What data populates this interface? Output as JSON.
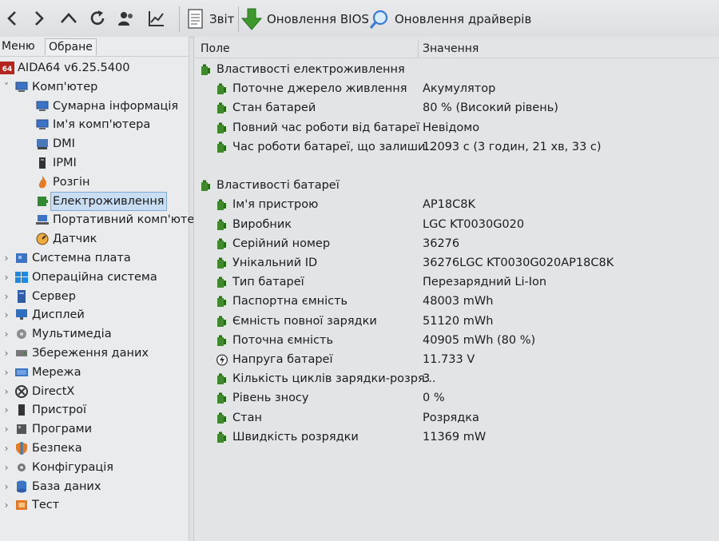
{
  "toolbar": {
    "nav_buttons": [
      "back",
      "forward",
      "up",
      "refresh",
      "users",
      "chart"
    ],
    "report_label": "Звіт",
    "bios_update_label": "Оновлення BIOS",
    "driver_update_label": "Оновлення драйверів"
  },
  "left_panel": {
    "tabs": [
      "Меню",
      "Обране"
    ],
    "tree": [
      {
        "label": "AIDA64 v6.25.5400",
        "icon": "aida64-logo-icon",
        "expander": ""
      },
      {
        "label": "Комп'ютер",
        "icon": "computer-icon",
        "expander": "˅"
      },
      {
        "label": "Сумарна інформація",
        "icon": "summary-icon",
        "expander": ""
      },
      {
        "label": "Ім'я комп'ютера",
        "icon": "computer-name-icon",
        "expander": ""
      },
      {
        "label": "DMI",
        "icon": "dmi-icon",
        "expander": ""
      },
      {
        "label": "IPMI",
        "icon": "ipmi-icon",
        "expander": ""
      },
      {
        "label": "Розгін",
        "icon": "overclock-flame-icon",
        "expander": ""
      },
      {
        "label": "Електроживлення",
        "icon": "power-battery-icon",
        "expander": ""
      },
      {
        "label": "Портативний комп'юте",
        "icon": "laptop-icon",
        "expander": ""
      },
      {
        "label": "Датчик",
        "icon": "sensor-gauge-icon",
        "expander": ""
      },
      {
        "label": "Системна плата",
        "icon": "motherboard-icon",
        "expander": "›"
      },
      {
        "label": "Операційна система",
        "icon": "windows-icon",
        "expander": "›"
      },
      {
        "label": "Сервер",
        "icon": "server-icon",
        "expander": "›"
      },
      {
        "label": "Дисплей",
        "icon": "display-icon",
        "expander": "›"
      },
      {
        "label": "Мультимедіа",
        "icon": "multimedia-icon",
        "expander": "›"
      },
      {
        "label": "Збереження даних",
        "icon": "storage-icon",
        "expander": "›"
      },
      {
        "label": "Мережа",
        "icon": "network-icon",
        "expander": "›"
      },
      {
        "label": "DirectX",
        "icon": "directx-icon",
        "expander": "›"
      },
      {
        "label": "Пристрої",
        "icon": "devices-icon",
        "expander": "›"
      },
      {
        "label": "Програми",
        "icon": "programs-icon",
        "expander": "›"
      },
      {
        "label": "Безпека",
        "icon": "security-shield-icon",
        "expander": "›"
      },
      {
        "label": "Конфігурація",
        "icon": "config-icon",
        "expander": "›"
      },
      {
        "label": "База даних",
        "icon": "database-icon",
        "expander": "›"
      },
      {
        "label": "Тест",
        "icon": "benchmark-icon",
        "expander": "›"
      }
    ],
    "selected_item": "Електроживлення",
    "icon_colors": {
      "blue": "#3b73c6",
      "green": "#2f8a2f",
      "orange": "#e8791e",
      "red": "#c0392b"
    }
  },
  "right_panel": {
    "columns": {
      "field": "Поле",
      "value": "Значення"
    },
    "groups": [
      {
        "title": "Властивості електроживлення",
        "rows": [
          {
            "field": "Поточне джерело живлення",
            "value": "Акумулятор",
            "icon": "battery-icon"
          },
          {
            "field": "Стан батарей",
            "value": "80 % (Високий рівень)",
            "icon": "battery-icon"
          },
          {
            "field": "Повний час роботи від батареї",
            "value": "Невідомо",
            "icon": "battery-icon"
          },
          {
            "field": "Час роботи батареї, що залиши...",
            "value": "12093 с (3 годин, 21 хв, 33 с)",
            "icon": "battery-icon"
          }
        ]
      },
      {
        "title": "Властивості батареї",
        "rows": [
          {
            "field": "Ім'я пристрою",
            "value": "AP18C8K",
            "icon": "battery-icon"
          },
          {
            "field": "Виробник",
            "value": "LGC KT0030G020",
            "icon": "battery-icon"
          },
          {
            "field": "Серійний номер",
            "value": "36276",
            "icon": "battery-icon"
          },
          {
            "field": "Унікальний ID",
            "value": "36276LGC KT0030G020AP18C8K",
            "icon": "battery-icon"
          },
          {
            "field": "Тип батареї",
            "value": "Перезарядний Li-Ion",
            "icon": "battery-icon"
          },
          {
            "field": "Паспортна ємність",
            "value": "48003 mWh",
            "icon": "battery-icon"
          },
          {
            "field": "Ємність повної зарядки",
            "value": "51120 mWh",
            "icon": "battery-icon"
          },
          {
            "field": "Поточна ємність",
            "value": "40905 mWh  (80 %)",
            "icon": "battery-icon"
          },
          {
            "field": "Напруга батареї",
            "value": "11.733 V",
            "icon": "voltage-icon"
          },
          {
            "field": "Кількість циклів зарядки-розря...",
            "value": "3",
            "icon": "battery-icon"
          },
          {
            "field": "Рівень зносу",
            "value": "0 %",
            "icon": "battery-icon"
          },
          {
            "field": "Стан",
            "value": "Розрядка",
            "icon": "battery-icon"
          },
          {
            "field": "Швидкість розрядки",
            "value": "11369 mW",
            "icon": "battery-icon"
          }
        ]
      }
    ]
  }
}
